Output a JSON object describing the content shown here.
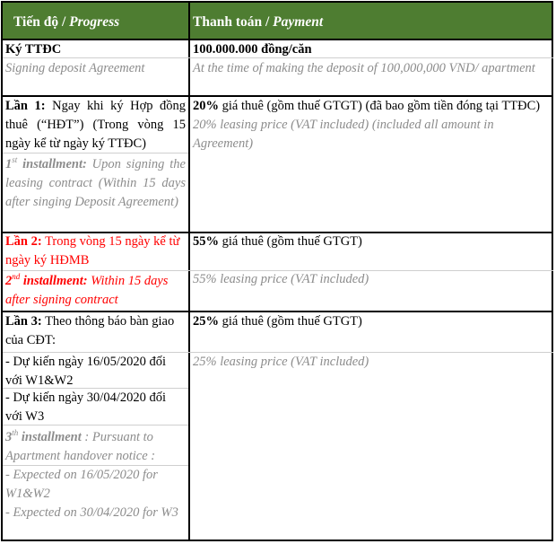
{
  "header": {
    "progress_vi": "Tiến độ / ",
    "progress_en": "Progress",
    "payment_vi": "Thanh toán / ",
    "payment_en": "Payment"
  },
  "colors": {
    "header_bg": "#4e7d31",
    "highlight": "#ff0000",
    "english_text": "#8c8c8c"
  },
  "rows": [
    {
      "progress_vi_bold": "Ký TTĐC",
      "progress_en": "Signing deposit Agreement",
      "payment_vi_bold": "100.000.000 đồng/căn",
      "payment_en": "At the time of making the deposit of 100,000,000 VND/ apartment"
    },
    {
      "progress_vi_bold": "Lần 1:",
      "progress_vi": " Ngay khi ký Hợp đồng thuê (“HĐT”) (Trong vòng 15 ngày kể từ ngày ký TTĐC)",
      "progress_en_num": "1",
      "progress_en_sup": "st",
      "progress_en_bold": " installment:",
      "progress_en": " Upon signing the leasing contract (Within 15 days after singing Deposit Agreement)",
      "payment_vi_bold": "20%",
      "payment_vi": " giá thuê (gồm thuế GTGT) (đã bao gồm tiền đóng tại TTĐC)",
      "payment_en": "20%  leasing price (VAT included) (included all amount in Agreement)"
    },
    {
      "progress_vi_bold": "Lần 2:",
      "progress_vi": " Trong vòng 15 ngày kể từ ngày ký HĐMB",
      "progress_en_num": "2",
      "progress_en_sup": "nd",
      "progress_en_bold": " installment:",
      "progress_en": " Within 15 days after signing contract",
      "payment_vi_bold": "55%",
      "payment_vi": " giá thuê (gồm thuế GTGT)",
      "payment_en": "55%  leasing price (VAT included)"
    },
    {
      "progress_vi_bold": "Lần 3:",
      "progress_vi": " Theo thông báo bàn giao của CĐT:",
      "progress_vi_items": [
        "- Dự kiến ngày 16/05/2020 đối với W1&W2",
        "- Dự kiến ngày 30/04/2020 đối với W3"
      ],
      "progress_en_num": "3",
      "progress_en_sup": "th",
      "progress_en_bold": " installment",
      "progress_en": " : Pursuant to Apartment handover notice :",
      "progress_en_items": [
        "- Expected on 16/05/2020 for W1&W2",
        "- Expected on 30/04/2020 for W3"
      ],
      "payment_vi_bold": "25%",
      "payment_vi": " giá thuê (gồm thuế GTGT)",
      "payment_en": "25%  leasing price (VAT included)"
    }
  ]
}
